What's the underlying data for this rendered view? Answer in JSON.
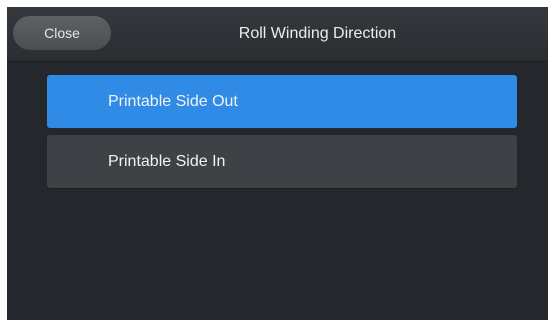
{
  "header": {
    "close_label": "Close",
    "title": "Roll Winding Direction"
  },
  "options": [
    {
      "label": "Printable Side Out",
      "selected": true
    },
    {
      "label": "Printable Side In",
      "selected": false
    }
  ],
  "colors": {
    "background": "#24272b",
    "header": "#2f3337",
    "selected": "#2f8be6",
    "option": "#3e4145",
    "close_button": "#55585c"
  }
}
